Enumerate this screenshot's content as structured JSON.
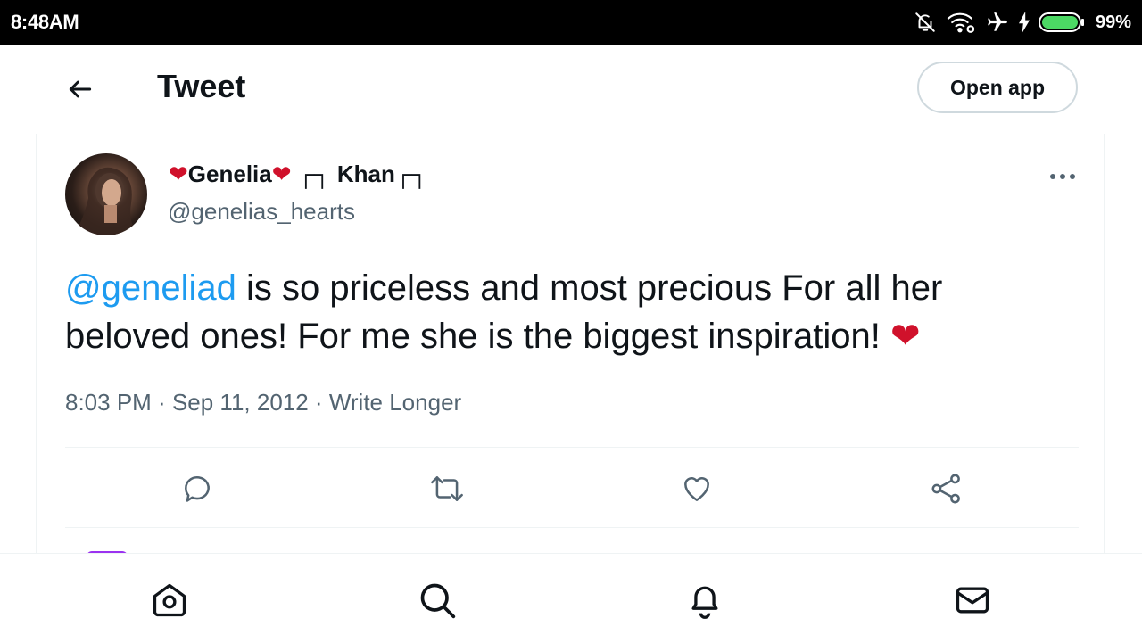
{
  "status_bar": {
    "time": "8:48AM",
    "battery_percent": "99%",
    "icons": [
      "notifications-off-icon",
      "wifi-icon",
      "airplane-mode-icon",
      "charging-icon",
      "battery-icon"
    ]
  },
  "header": {
    "title": "Tweet",
    "open_app_label": "Open app",
    "back_icon": "arrow-left-icon"
  },
  "tweet": {
    "author": {
      "name_prefix_heart": "❤",
      "name_main": "Genelia",
      "name_suffix_heart": "❤",
      "name_rest": " ┌┐ Khan┌┐",
      "handle": "@genelias_hearts"
    },
    "text": {
      "mention": "@geneliad",
      "body": " is so priceless and most precious For all her beloved ones! For me she is the biggest inspiration! ",
      "emoji": "❤"
    },
    "meta": {
      "time": "8:03 PM",
      "separator": " · ",
      "date": "Sep 11, 2012",
      "source": "Write Longer"
    },
    "actions": [
      "reply-icon",
      "retweet-icon",
      "like-icon",
      "share-icon"
    ]
  },
  "bottom_nav": {
    "items": [
      "home-icon",
      "search-icon",
      "notifications-icon",
      "messages-icon"
    ]
  },
  "colors": {
    "accent": "#1d9bf0",
    "text_primary": "#0f1419",
    "text_secondary": "#536471",
    "heart": "#d0112b",
    "battery": "#4cd964",
    "border": "#cfd9de"
  }
}
